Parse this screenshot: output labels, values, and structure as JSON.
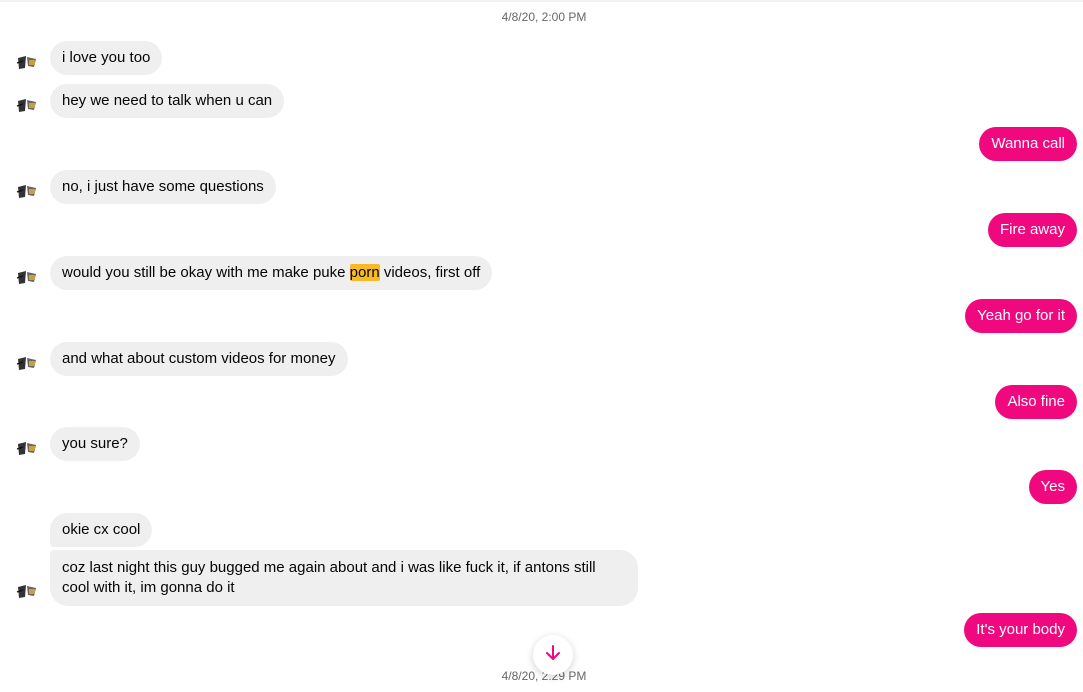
{
  "colors": {
    "incoming_bubble": "#efefef",
    "outgoing_bubble": "#f0087f",
    "highlight": "#f7b925",
    "timestamp": "#65676b"
  },
  "timestamps": {
    "top": "4/8/20, 2:00 PM",
    "bottom": "4/8/20, 2:29 PM"
  },
  "messages": [
    {
      "from": "them",
      "text": "i love you too"
    },
    {
      "from": "them",
      "text": "hey we need to talk when u can"
    },
    {
      "from": "me",
      "text": "Wanna call"
    },
    {
      "from": "them",
      "text": "no, i just have some questions"
    },
    {
      "from": "me",
      "text": "Fire away"
    },
    {
      "from": "them",
      "text_before": "would you still be okay with me make puke ",
      "highlight": "porn",
      "text_after": " videos, first off"
    },
    {
      "from": "me",
      "text": "Yeah go for it"
    },
    {
      "from": "them",
      "text": "and what about custom videos for money"
    },
    {
      "from": "me",
      "text": "Also fine"
    },
    {
      "from": "them",
      "text": "you sure?"
    },
    {
      "from": "me",
      "text": "Yes"
    },
    {
      "from": "them",
      "text": "okie cx cool"
    },
    {
      "from": "them",
      "text": "coz last night this guy bugged me again about and i was like fuck it, if antons still cool with it, im gonna do it"
    },
    {
      "from": "me",
      "text": "It's your body"
    }
  ],
  "icons": {
    "avatar": "contact-avatar",
    "scroll": "arrow-down-icon"
  }
}
